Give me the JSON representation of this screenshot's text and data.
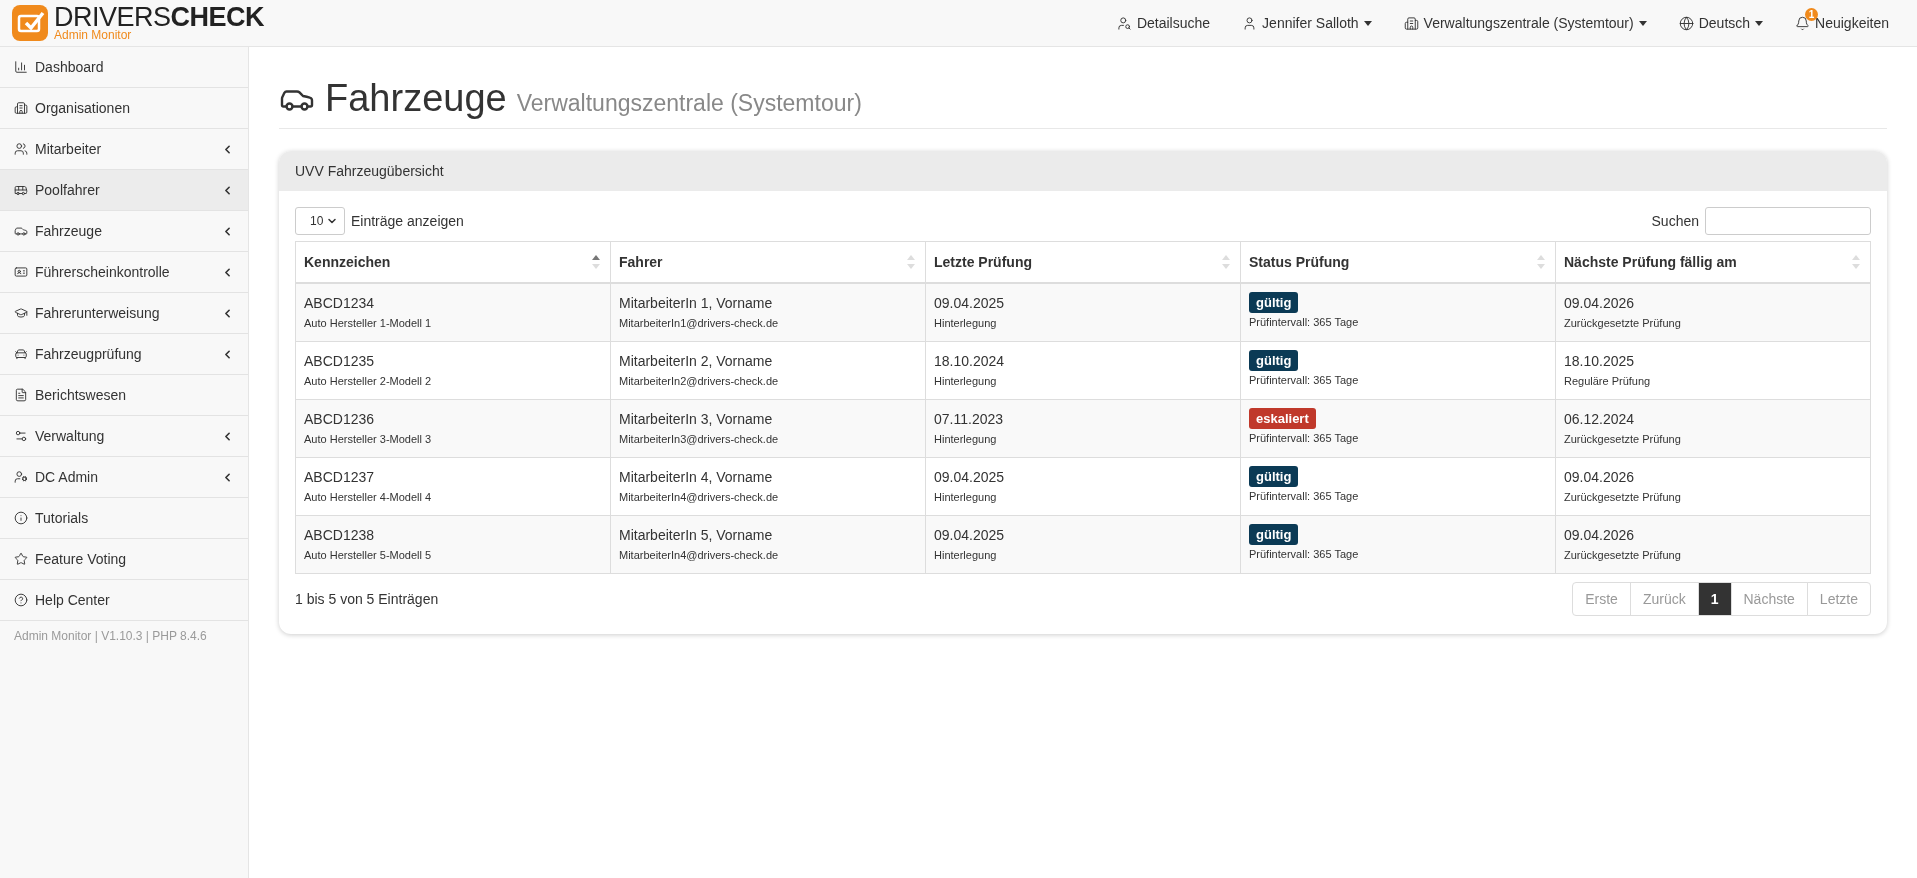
{
  "brand": {
    "name_light": "DRIVERS",
    "name_bold": "CHECK",
    "tagline": "Admin Monitor"
  },
  "topnav": [
    {
      "label": "Detailsuche",
      "dropdown": false
    },
    {
      "label": "Jennifer Salloth",
      "dropdown": true
    },
    {
      "label": "Verwaltungszentrale (Systemtour)",
      "dropdown": true
    },
    {
      "label": "Deutsch",
      "dropdown": true
    },
    {
      "label": "Neuigkeiten",
      "dropdown": false,
      "badge": "1"
    }
  ],
  "sidebar": {
    "items": [
      {
        "label": "Dashboard",
        "selected": false,
        "submenu": false
      },
      {
        "label": "Organisationen",
        "selected": false,
        "submenu": false
      },
      {
        "label": "Mitarbeiter",
        "selected": false,
        "submenu": true
      },
      {
        "label": "Poolfahrer",
        "selected": true,
        "submenu": true
      },
      {
        "label": "Fahrzeuge",
        "selected": false,
        "submenu": true
      },
      {
        "label": "Führerscheinkontrolle",
        "selected": false,
        "submenu": true
      },
      {
        "label": "Fahrerunterweisung",
        "selected": false,
        "submenu": true
      },
      {
        "label": "Fahrzeugprüfung",
        "selected": false,
        "submenu": true
      },
      {
        "label": "Berichtswesen",
        "selected": false,
        "submenu": false
      },
      {
        "label": "Verwaltung",
        "selected": false,
        "submenu": true
      },
      {
        "label": "DC Admin",
        "selected": false,
        "submenu": true
      },
      {
        "label": "Tutorials",
        "selected": false,
        "submenu": false
      },
      {
        "label": "Feature Voting",
        "selected": false,
        "submenu": false
      },
      {
        "label": "Help Center",
        "selected": false,
        "submenu": false
      }
    ],
    "footer": "Admin Monitor | V1.10.3 | PHP 8.4.6"
  },
  "page": {
    "title": "Fahrzeuge",
    "subtitle": "Verwaltungszentrale (Systemtour)"
  },
  "card": {
    "title": "UVV Fahrzeugübersicht",
    "length_select": {
      "value": "10",
      "label": "Einträge anzeigen"
    },
    "search": {
      "label": "Suchen"
    },
    "table": {
      "columns": [
        {
          "label": "Kennzeichen",
          "sorted": true
        },
        {
          "label": "Fahrer",
          "sorted": false
        },
        {
          "label": "Letzte Prüfung",
          "sorted": false
        },
        {
          "label": "Status Prüfung",
          "sorted": false
        },
        {
          "label": "Nächste Prüfung fällig am",
          "sorted": false
        }
      ],
      "rows": [
        {
          "plate": "ABCD1234",
          "model": "Auto Hersteller 1-Modell 1",
          "driver": "MitarbeiterIn 1, Vorname",
          "email": "MitarbeiterIn1@drivers-check.de",
          "last": "09.04.2025",
          "last_note": "Hinterlegung",
          "status": "gültig",
          "color": "#0b3a55",
          "interval": "Prüfintervall: 365 Tage",
          "next": "09.04.2026",
          "next_note": "Zurückgesetzte Prüfung"
        },
        {
          "plate": "ABCD1235",
          "model": "Auto Hersteller 2-Modell 2",
          "driver": "MitarbeiterIn 2, Vorname",
          "email": "MitarbeiterIn2@drivers-check.de",
          "last": "18.10.2024",
          "last_note": "Hinterlegung",
          "status": "gültig",
          "color": "#0b3a55",
          "interval": "Prüfintervall: 365 Tage",
          "next": "18.10.2025",
          "next_note": "Reguläre Prüfung"
        },
        {
          "plate": "ABCD1236",
          "model": "Auto Hersteller 3-Modell 3",
          "driver": "MitarbeiterIn 3, Vorname",
          "email": "MitarbeiterIn3@drivers-check.de",
          "last": "07.11.2023",
          "last_note": "Hinterlegung",
          "status": "eskaliert",
          "color": "#c0392b",
          "interval": "Prüfintervall: 365 Tage",
          "next": "06.12.2024",
          "next_note": "Zurückgesetzte Prüfung"
        },
        {
          "plate": "ABCD1237",
          "model": "Auto Hersteller 4-Modell 4",
          "driver": "MitarbeiterIn 4, Vorname",
          "email": "MitarbeiterIn4@drivers-check.de",
          "last": "09.04.2025",
          "last_note": "Hinterlegung",
          "status": "gültig",
          "color": "#0b3a55",
          "interval": "Prüfintervall: 365 Tage",
          "next": "09.04.2026",
          "next_note": "Zurückgesetzte Prüfung"
        },
        {
          "plate": "ABCD1238",
          "model": "Auto Hersteller 5-Modell 5",
          "driver": "MitarbeiterIn 5, Vorname",
          "email": "MitarbeiterIn4@drivers-check.de",
          "last": "09.04.2025",
          "last_note": "Hinterlegung",
          "status": "gültig",
          "color": "#0b3a55",
          "interval": "Prüfintervall: 365 Tage",
          "next": "09.04.2026",
          "next_note": "Zurückgesetzte Prüfung"
        }
      ]
    },
    "info": "1 bis 5 von 5 Einträgen",
    "pagination": [
      {
        "label": "Erste",
        "selected": false,
        "disabled": true
      },
      {
        "label": "Zurück",
        "selected": false,
        "disabled": true
      },
      {
        "label": "1",
        "selected": true,
        "disabled": false
      },
      {
        "label": "Nächste",
        "selected": false,
        "disabled": true
      },
      {
        "label": "Letzte",
        "selected": false,
        "disabled": true
      }
    ]
  }
}
